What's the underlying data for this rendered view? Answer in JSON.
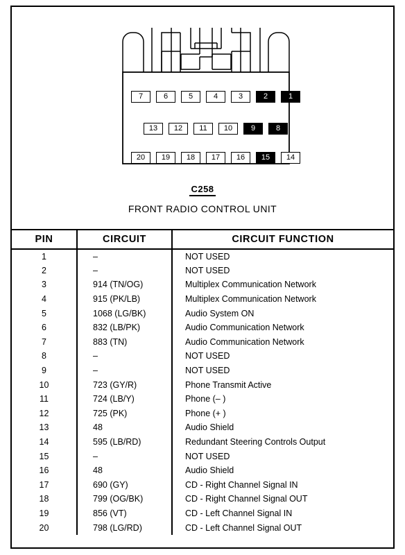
{
  "connector": {
    "label": "C258",
    "subtitle": "FRONT RADIO CONTROL UNIT",
    "rows": [
      {
        "name": "top-row",
        "pins": [
          {
            "num": "7",
            "filled": false
          },
          {
            "num": "6",
            "filled": false
          },
          {
            "num": "5",
            "filled": false
          },
          {
            "num": "4",
            "filled": false
          },
          {
            "num": "3",
            "filled": false
          },
          {
            "num": "2",
            "filled": true
          },
          {
            "num": "1",
            "filled": true
          }
        ]
      },
      {
        "name": "middle-row",
        "pins": [
          {
            "num": "13",
            "filled": false
          },
          {
            "num": "12",
            "filled": false
          },
          {
            "num": "11",
            "filled": false
          },
          {
            "num": "10",
            "filled": false
          },
          {
            "num": "9",
            "filled": true
          },
          {
            "num": "8",
            "filled": true
          }
        ]
      },
      {
        "name": "bottom-row",
        "pins": [
          {
            "num": "20",
            "filled": false
          },
          {
            "num": "19",
            "filled": false
          },
          {
            "num": "18",
            "filled": false
          },
          {
            "num": "17",
            "filled": false
          },
          {
            "num": "16",
            "filled": false
          },
          {
            "num": "15",
            "filled": true
          },
          {
            "num": "14",
            "filled": false
          }
        ]
      }
    ]
  },
  "table": {
    "headers": [
      "PIN",
      "CIRCUIT",
      "CIRCUIT FUNCTION"
    ],
    "rows": [
      {
        "pin": "1",
        "circuit": "–",
        "function": "NOT USED"
      },
      {
        "pin": "2",
        "circuit": "–",
        "function": "NOT USED"
      },
      {
        "pin": "3",
        "circuit": "914 (TN/OG)",
        "function": "Multiplex Communication Network"
      },
      {
        "pin": "4",
        "circuit": "915 (PK/LB)",
        "function": "Multiplex Communication Network"
      },
      {
        "pin": "5",
        "circuit": "1068 (LG/BK)",
        "function": "Audio System ON"
      },
      {
        "pin": "6",
        "circuit": "832 (LB/PK)",
        "function": "Audio Communication Network"
      },
      {
        "pin": "7",
        "circuit": "883 (TN)",
        "function": "Audio Communication Network"
      },
      {
        "pin": "8",
        "circuit": "–",
        "function": "NOT USED"
      },
      {
        "pin": "9",
        "circuit": "–",
        "function": "NOT USED"
      },
      {
        "pin": "10",
        "circuit": "723 (GY/R)",
        "function": "Phone Transmit Active"
      },
      {
        "pin": "11",
        "circuit": "724 (LB/Y)",
        "function": "Phone (– )"
      },
      {
        "pin": "12",
        "circuit": "725 (PK)",
        "function": "Phone (+ )"
      },
      {
        "pin": "13",
        "circuit": "48",
        "function": "Audio Shield"
      },
      {
        "pin": "14",
        "circuit": "595 (LB/RD)",
        "function": "Redundant Steering Controls Output"
      },
      {
        "pin": "15",
        "circuit": "–",
        "function": "NOT USED"
      },
      {
        "pin": "16",
        "circuit": "48",
        "function": "Audio Shield"
      },
      {
        "pin": "17",
        "circuit": "690 (GY)",
        "function": "CD  -  Right Channel Signal IN"
      },
      {
        "pin": "18",
        "circuit": "799 (OG/BK)",
        "function": "CD  -  Right Channel Signal OUT"
      },
      {
        "pin": "19",
        "circuit": "856 (VT)",
        "function": "CD  -  Left Channel Signal IN"
      },
      {
        "pin": "20",
        "circuit": "798 (LG/RD)",
        "function": "CD  -  Left Channel Signal OUT"
      }
    ]
  },
  "colors": {
    "line": "#000000",
    "background": "#ffffff",
    "filled_pin": "#000000"
  }
}
